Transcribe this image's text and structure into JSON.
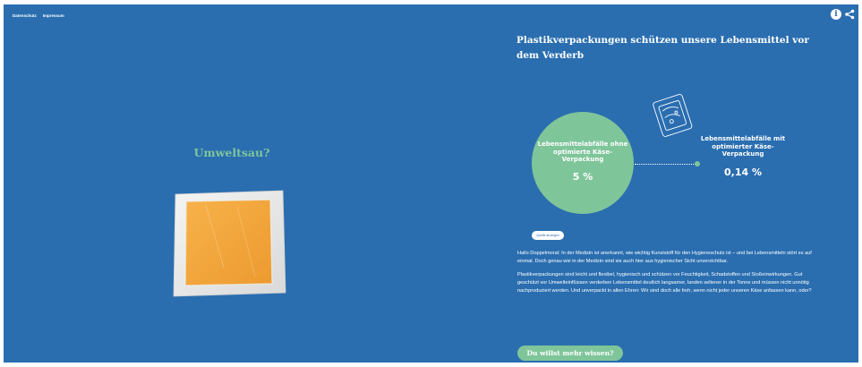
{
  "nav": {
    "privacy": "Datenschutz",
    "imprint": "Impressum"
  },
  "header_icons": {
    "info": "info-icon",
    "share": "share-icon"
  },
  "left": {
    "title": "Umweltsau?",
    "image": "cheese-in-vacuum-pack"
  },
  "right": {
    "heading": "Plastikverpackungen schützen unsere Lebensmittel vor dem Verderb",
    "comparison": {
      "without": {
        "label": "Lebensmittelabfälle ohne optimierte Käse-Verpackung",
        "value": "5 %"
      },
      "with": {
        "label": "Lebensmittelabfälle mit optimierter Käse-Verpackung",
        "value": "0,14 %"
      }
    },
    "source_button": "Quelle anzeigen",
    "paragraphs": [
      "Hallo Doppelmoral: In der Medizin ist anerkannt, wie wichtig Kunststoff für den Hygieneschutz ist – und bei Lebensmitteln stört es auf einmal. Doch genau wie in der Medizin sind sie auch hier aus hygienischer Sicht unverzichtbar.",
      "Plastikverpackungen sind leicht und flexibel, hygienisch und schützen vor Feuchtigkeit, Schadstoffen und Stoßeinwirkungen. Gut geschützt vor Umwelteinflüssen verderben Lebensmittel deutlich langsamer, landen seltener in der Tonne und müssen nicht unnötig nachproduziert werden. Und unverpackt in allen Ehren: Wir sind doch alle froh, wenn nicht jeder unseren Käse anfassen kann, oder?"
    ],
    "more_button": "Du willst mehr wissen?"
  },
  "colors": {
    "background": "#2a6eb0",
    "accent_green": "#7fc59a",
    "cheese": "#f2a33a",
    "text": "#ffffff"
  }
}
